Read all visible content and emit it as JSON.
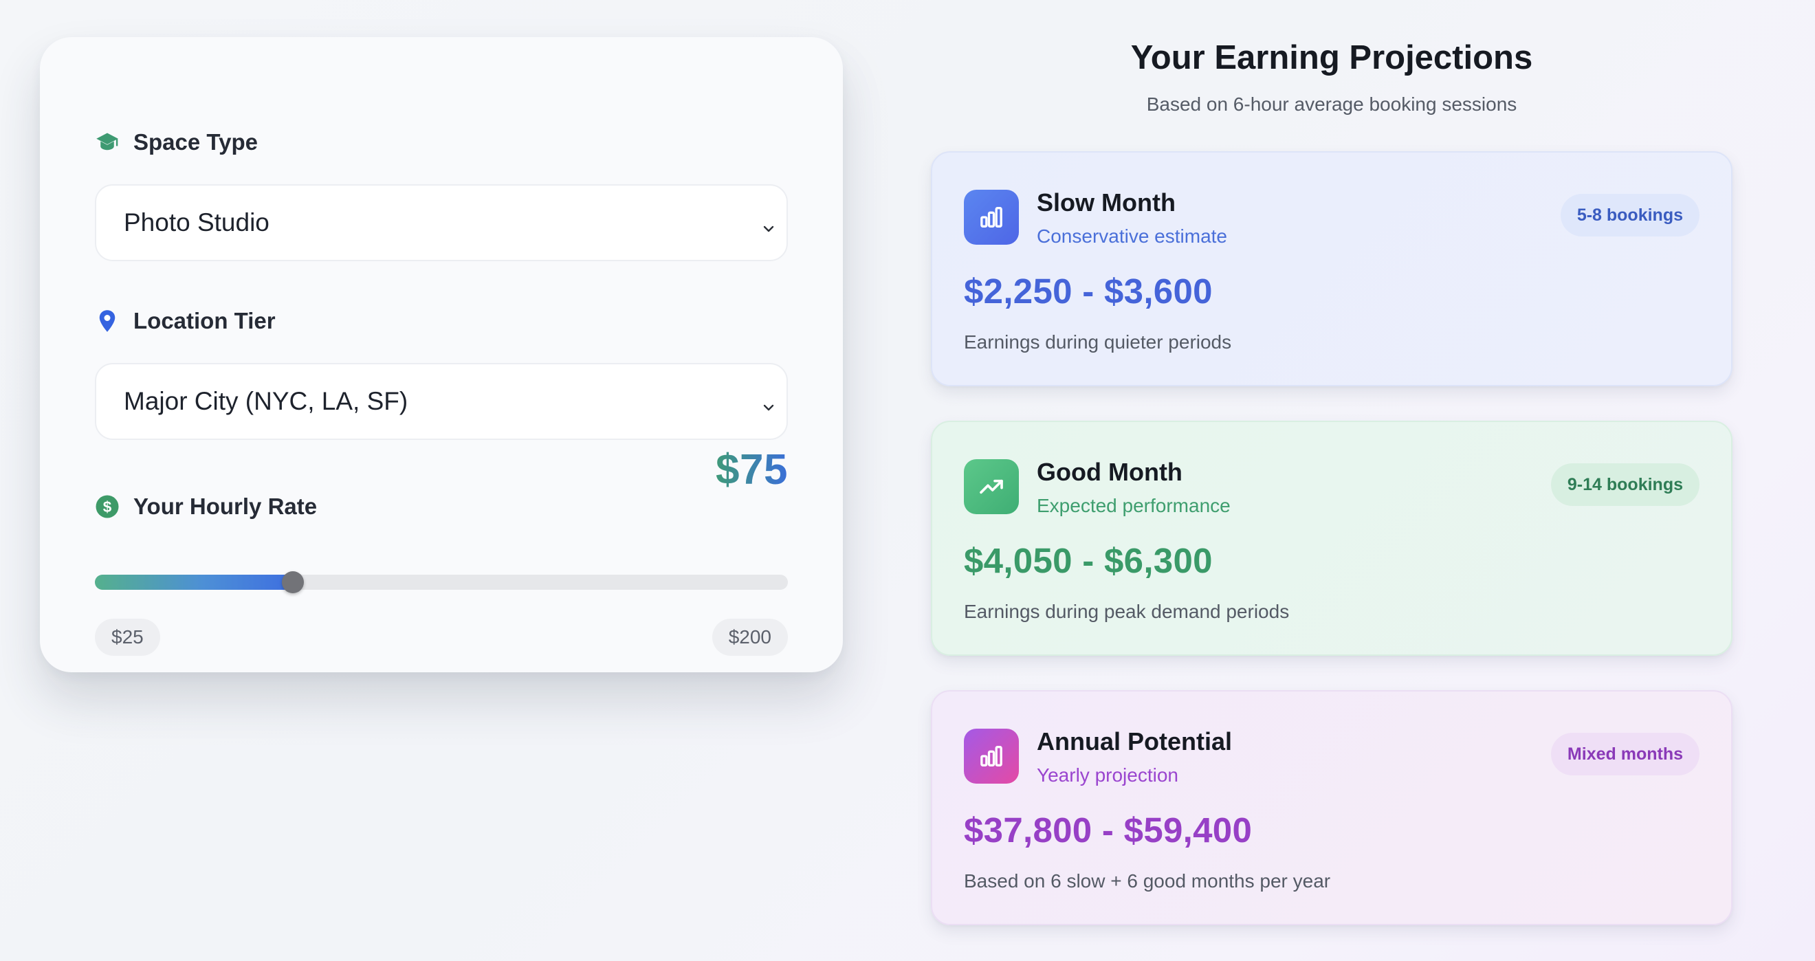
{
  "calculator": {
    "space_type": {
      "label": "Space Type",
      "icon": "graduation-cap-icon",
      "selected": "Photo Studio"
    },
    "location_tier": {
      "label": "Location Tier",
      "icon": "map-pin-icon",
      "selected": "Major City (NYC, LA, SF)"
    },
    "hourly_rate": {
      "label": "Your Hourly Rate",
      "icon": "dollar-circle-icon",
      "value_display": "$75",
      "value": 75,
      "min": 25,
      "max": 200,
      "min_label": "$25",
      "max_label": "$200"
    }
  },
  "projections": {
    "title": "Your Earning Projections",
    "subtitle": "Based on 6-hour average booking sessions",
    "cards": [
      {
        "title": "Slow Month",
        "subtitle": "Conservative estimate",
        "badge": "5-8 bookings",
        "amount": "$2,250 - $3,600",
        "description": "Earnings during quieter periods",
        "icon": "bar-chart-icon"
      },
      {
        "title": "Good Month",
        "subtitle": "Expected performance",
        "badge": "9-14 bookings",
        "amount": "$4,050 - $6,300",
        "description": "Earnings during peak demand periods",
        "icon": "trending-up-icon"
      },
      {
        "title": "Annual Potential",
        "subtitle": "Yearly projection",
        "badge": "Mixed months",
        "amount": "$37,800 - $59,400",
        "description": "Based on 6 slow + 6 good months per year",
        "icon": "bar-chart-icon"
      }
    ]
  },
  "colors": {
    "green_accent": "#3f9a79",
    "blue_accent": "#3b6fd8",
    "purple_accent": "#9740c6"
  }
}
